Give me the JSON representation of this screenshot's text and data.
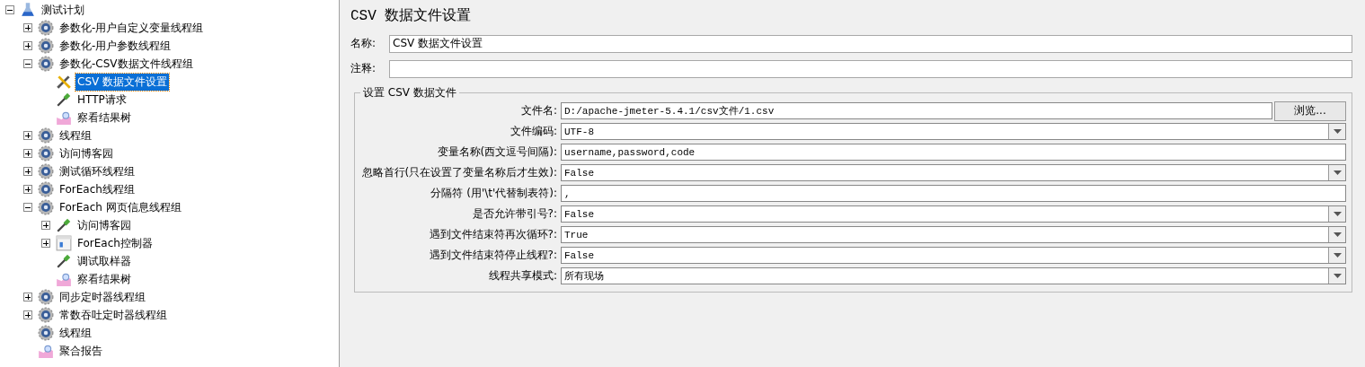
{
  "tree": [
    {
      "label": "测试计划",
      "kind": "plan",
      "expanded": true,
      "selected": false,
      "children": [
        {
          "label": "参数化-用户自定义变量线程组",
          "kind": "threadgroup",
          "expanded": false,
          "selected": false
        },
        {
          "label": "参数化-用户参数线程组",
          "kind": "threadgroup",
          "expanded": false,
          "selected": false
        },
        {
          "label": "参数化-CSV数据文件线程组",
          "kind": "threadgroup",
          "expanded": true,
          "selected": false,
          "children": [
            {
              "label": "CSV 数据文件设置",
              "kind": "config",
              "selected": true
            },
            {
              "label": "HTTP请求",
              "kind": "sampler",
              "selected": false
            },
            {
              "label": "察看结果树",
              "kind": "listener",
              "selected": false
            }
          ]
        },
        {
          "label": "线程组",
          "kind": "threadgroup",
          "expanded": false,
          "selected": false
        },
        {
          "label": "访问博客园",
          "kind": "threadgroup",
          "expanded": false,
          "selected": false
        },
        {
          "label": "测试循环线程组",
          "kind": "threadgroup",
          "expanded": false,
          "selected": false
        },
        {
          "label": "ForEach线程组",
          "kind": "threadgroup",
          "expanded": false,
          "selected": false
        },
        {
          "label": "ForEach 网页信息线程组",
          "kind": "threadgroup",
          "expanded": true,
          "selected": false,
          "children": [
            {
              "label": "访问博客园",
              "kind": "sampler",
              "expanded": false,
              "selected": false
            },
            {
              "label": "ForEach控制器",
              "kind": "controller",
              "expanded": false,
              "selected": false
            },
            {
              "label": "调试取样器",
              "kind": "sampler",
              "selected": false
            },
            {
              "label": "察看结果树",
              "kind": "listener",
              "selected": false
            }
          ]
        },
        {
          "label": "同步定时器线程组",
          "kind": "threadgroup",
          "expanded": false,
          "selected": false
        },
        {
          "label": "常数吞吐定时器线程组",
          "kind": "threadgroup",
          "expanded": false,
          "selected": false
        },
        {
          "label": "线程组",
          "kind": "threadgroup",
          "selected": false
        },
        {
          "label": "聚合报告",
          "kind": "listener",
          "selected": false
        }
      ]
    }
  ],
  "panel": {
    "title": "CSV 数据文件设置",
    "name_label": "名称:",
    "name_value": "CSV 数据文件设置",
    "comment_label": "注释:",
    "group_title": "设置 CSV 数据文件",
    "fields": [
      {
        "label": "文件名:",
        "kind": "file",
        "value": "D:/apache-jmeter-5.4.1/csv文件/1.csv",
        "button": "浏览..."
      },
      {
        "label": "文件编码:",
        "kind": "combo",
        "value": "UTF-8"
      },
      {
        "label": "变量名称(西文逗号间隔):",
        "kind": "text",
        "value": "username,password,code"
      },
      {
        "label": "忽略首行(只在设置了变量名称后才生效):",
        "kind": "combo",
        "value": "False"
      },
      {
        "label": "分隔符 (用'\\t'代替制表符):",
        "kind": "text",
        "value": ","
      },
      {
        "label": "是否允许带引号?:",
        "kind": "combo",
        "value": "False"
      },
      {
        "label": "遇到文件结束符再次循环?:",
        "kind": "combo",
        "value": "True"
      },
      {
        "label": "遇到文件结束符停止线程?:",
        "kind": "combo",
        "value": "False"
      },
      {
        "label": "线程共享模式:",
        "kind": "combo",
        "value": "所有现场"
      }
    ]
  }
}
